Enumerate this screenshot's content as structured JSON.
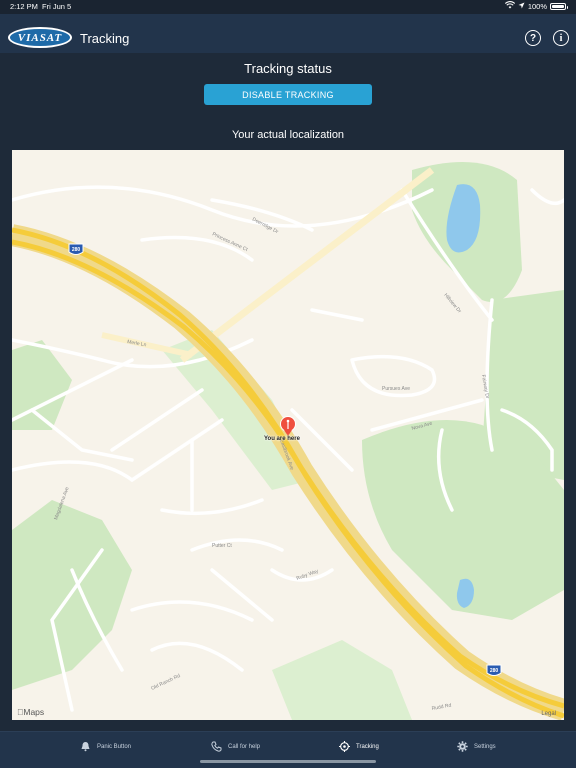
{
  "status_bar": {
    "time": "2:12 PM",
    "date": "Fri Jun 5",
    "battery": "100%"
  },
  "header": {
    "logo_text": "VIASAT",
    "title": "Tracking"
  },
  "main": {
    "status_title": "Tracking status",
    "disable_button": "DISABLE TRACKING",
    "location_label": "Your actual localization"
  },
  "map": {
    "pin_label": "You are here",
    "attribution": "Maps",
    "legal": "Legal",
    "highway_shield": "280",
    "streets": {
      "princess": "Princess Anne Ct",
      "deerridge": "Deerridge Dr",
      "merle": "Merle Ln",
      "hillview": "Hillview Dr",
      "pursues": "Pursues Ave",
      "fairway": "Fairway Dr",
      "nova": "Nova Ave",
      "magdalena": "Magdalena Ave",
      "putter": "Putter Ct",
      "eastbrook": "Eastbrook Ave",
      "old_ranch": "Old Ranch Rd",
      "ruby": "Ruby Way",
      "rudd": "Rudd Rd"
    }
  },
  "tabs": [
    {
      "label": "Panic Button",
      "icon": "bell-icon"
    },
    {
      "label": "Call for help",
      "icon": "phone-icon"
    },
    {
      "label": "Tracking",
      "icon": "crosshair-icon"
    },
    {
      "label": "Settings",
      "icon": "gear-icon"
    }
  ],
  "colors": {
    "background": "#1e2a39",
    "navbar": "#22344b",
    "accent": "#29a2d4",
    "highway": "#f5cc3a",
    "park": "#cfe8c1",
    "water": "#8fc8ec",
    "pin": "#ef4f3e"
  }
}
